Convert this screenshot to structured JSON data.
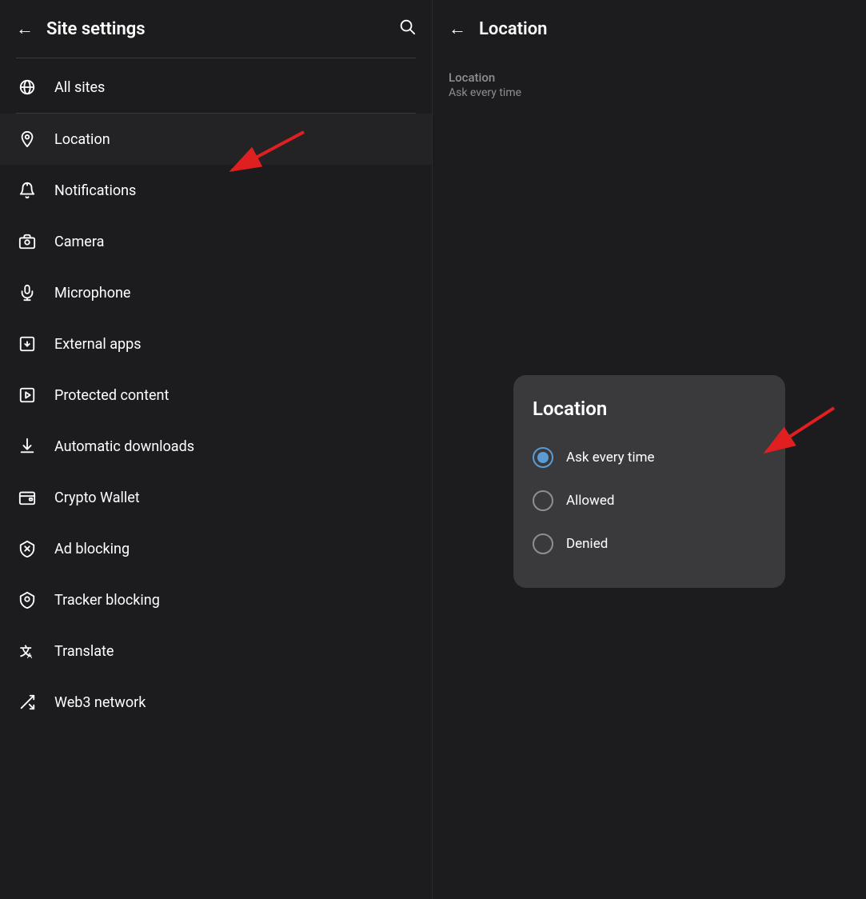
{
  "left": {
    "header": {
      "back_label": "←",
      "title": "Site settings",
      "search_label": "🔍"
    },
    "menu_items": [
      {
        "id": "all-sites",
        "label": "All sites",
        "icon": "globe"
      },
      {
        "id": "location",
        "label": "Location",
        "icon": "location",
        "active": true
      },
      {
        "id": "notifications",
        "label": "Notifications",
        "icon": "bell"
      },
      {
        "id": "camera",
        "label": "Camera",
        "icon": "camera"
      },
      {
        "id": "microphone",
        "label": "Microphone",
        "icon": "microphone"
      },
      {
        "id": "external-apps",
        "label": "External apps",
        "icon": "external"
      },
      {
        "id": "protected-content",
        "label": "Protected content",
        "icon": "play"
      },
      {
        "id": "automatic-downloads",
        "label": "Automatic downloads",
        "icon": "download"
      },
      {
        "id": "crypto-wallet",
        "label": "Crypto Wallet",
        "icon": "wallet"
      },
      {
        "id": "ad-blocking",
        "label": "Ad blocking",
        "icon": "shield-x"
      },
      {
        "id": "tracker-blocking",
        "label": "Tracker blocking",
        "icon": "shield-check"
      },
      {
        "id": "translate",
        "label": "Translate",
        "icon": "translate"
      },
      {
        "id": "web3-network",
        "label": "Web3 network",
        "icon": "web3"
      }
    ]
  },
  "right": {
    "header": {
      "back_label": "←",
      "title": "Location"
    },
    "info": {
      "label": "Location",
      "value": "Ask every time"
    },
    "dialog": {
      "title": "Location",
      "options": [
        {
          "id": "ask",
          "label": "Ask every time",
          "selected": true
        },
        {
          "id": "allowed",
          "label": "Allowed",
          "selected": false
        },
        {
          "id": "denied",
          "label": "Denied",
          "selected": false
        }
      ]
    }
  }
}
